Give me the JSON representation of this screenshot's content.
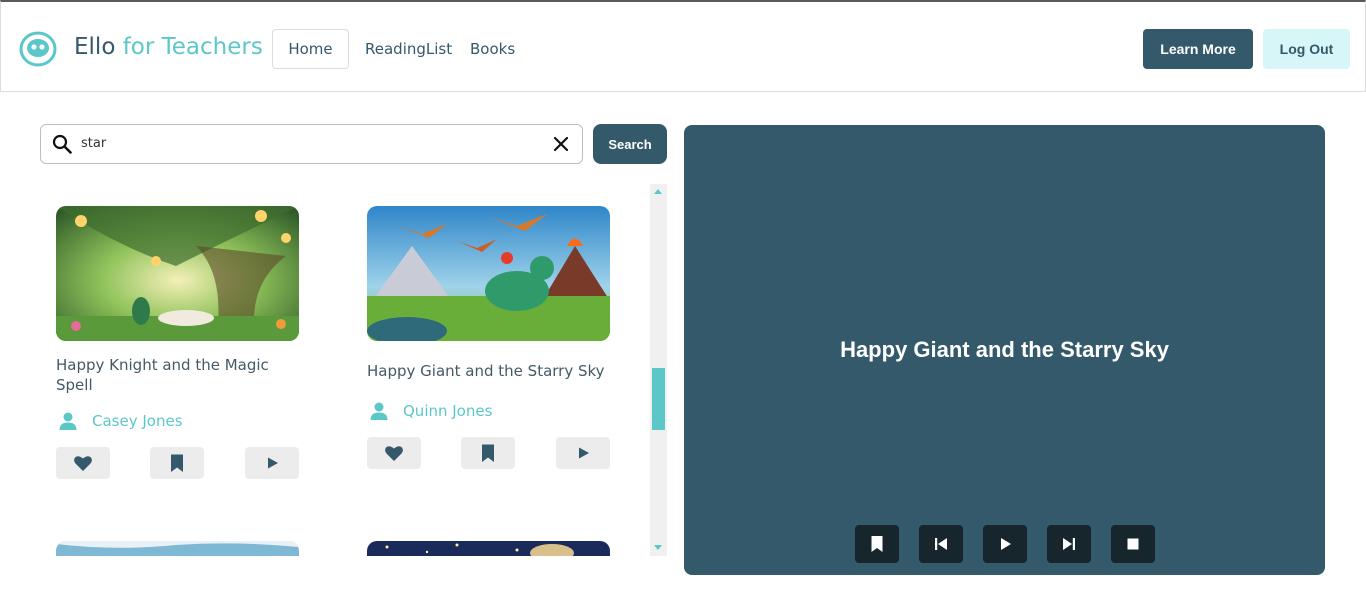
{
  "header": {
    "brand_main": "Ello",
    "brand_accent": "for Teachers",
    "nav": {
      "home": "Home",
      "reading_list": "ReadingList",
      "books": "Books"
    },
    "learn_more": "Learn More",
    "log_out": "Log Out"
  },
  "search": {
    "value": "star",
    "button": "Search"
  },
  "books": [
    {
      "title": "Happy Knight and the Magic Spell",
      "author": "Casey Jones"
    },
    {
      "title": "Happy Giant and the Starry Sky",
      "author": "Quinn Jones"
    }
  ],
  "player": {
    "title": "Happy Giant and the Starry Sky"
  },
  "colors": {
    "primary": "#34596b",
    "accent": "#5cc7c9",
    "player_button": "#17262d"
  },
  "icons": {
    "logo": "ello-logo-icon",
    "search": "search-icon",
    "clear": "close-icon",
    "author": "user-icon",
    "like": "heart-icon",
    "bookmark": "bookmark-icon",
    "play": "play-icon",
    "prev": "skip-previous-icon",
    "next": "skip-next-icon",
    "stop": "stop-icon"
  }
}
